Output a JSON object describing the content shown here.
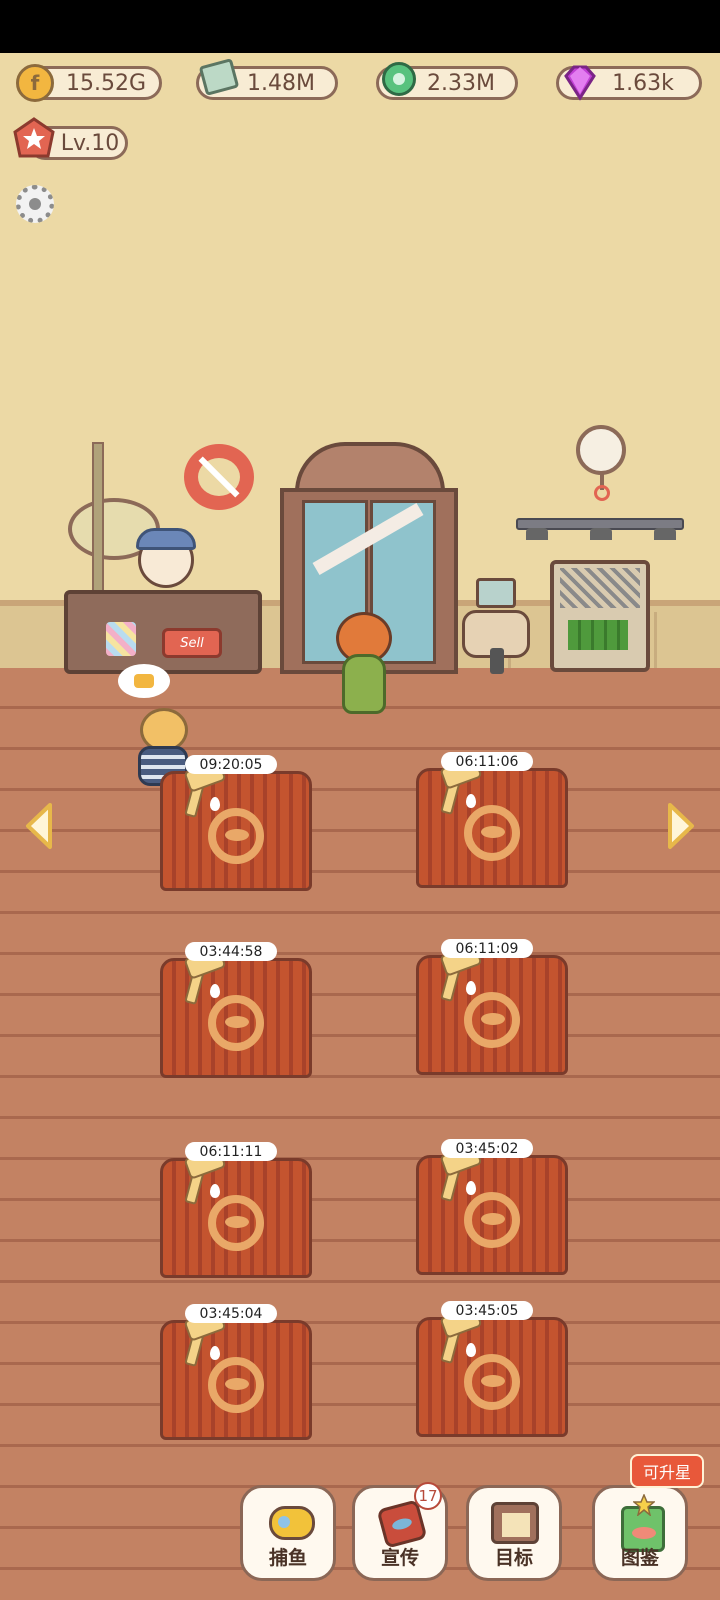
{
  "currencies": {
    "coins": "15.52G",
    "cash": "1.48M",
    "gems_green": "2.33M",
    "diamonds": "1.63k"
  },
  "player": {
    "level": "Lv.10"
  },
  "shop": {
    "sell_sign": "Sell"
  },
  "stalls": [
    {
      "timer": "09:20:05"
    },
    {
      "timer": "06:11:06"
    },
    {
      "timer": "03:44:58"
    },
    {
      "timer": "06:11:09"
    },
    {
      "timer": "06:11:11"
    },
    {
      "timer": "03:45:02"
    },
    {
      "timer": "03:45:04"
    },
    {
      "timer": "03:45:05"
    }
  ],
  "bottom_nav": {
    "fishing": "捕鱼",
    "promote": "宣传",
    "promote_badge": "17",
    "goals": "目标",
    "encyclopedia": "图鉴",
    "encyclopedia_tag": "可升星"
  },
  "colors": {
    "accent": "#e8583a",
    "wall": "#ecd9a5",
    "floor": "#c38263"
  }
}
